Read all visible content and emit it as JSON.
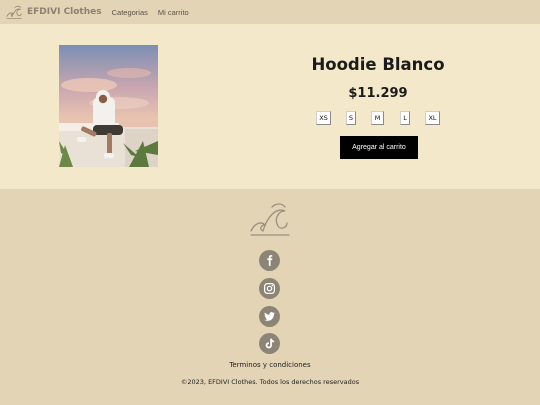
{
  "navbar": {
    "brand_name": "EFDIVI Clothes",
    "links": [
      "Categorias",
      "Mi carrito"
    ]
  },
  "product": {
    "title": "Hoodie Blanco",
    "price": "$11.299",
    "sizes": [
      "XS",
      "S",
      "M",
      "L",
      "XL"
    ],
    "add_to_cart_label": "Agregar al carrito"
  },
  "footer": {
    "social_icons": [
      "facebook-icon",
      "instagram-icon",
      "twitter-icon",
      "tiktok-icon"
    ],
    "terms_label": "Terminos y condiciones",
    "copyright": "©2023, EFDIVI Clothes. Todos los derechos reservados"
  },
  "colors": {
    "page_background": "#e2d4b4",
    "product_background": "#f4e8cb",
    "social_icon_bg": "#8c8475",
    "button_bg": "#000000"
  }
}
